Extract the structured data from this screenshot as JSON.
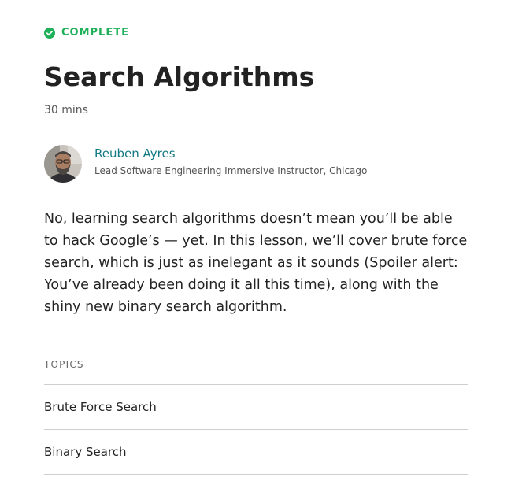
{
  "status": {
    "label": "COMPLETE",
    "icon": "check-circle-icon",
    "color": "#1fb05a"
  },
  "lesson": {
    "title": "Search Algorithms",
    "duration": "30 mins",
    "description": "No, learning search algorithms doesn’t mean you’ll be able to hack Google’s — yet. In this lesson, we’ll cover brute force search, which is just as inelegant as it sounds (Spoiler alert: You’ve already been doing it all this time), along with the shiny new binary search algorithm."
  },
  "author": {
    "name": "Reuben Ayres",
    "role": "Lead Software Engineering Immersive Instructor, Chicago",
    "name_color": "#137a83"
  },
  "topics": {
    "heading": "TOPICS",
    "items": [
      {
        "label": "Brute Force Search"
      },
      {
        "label": "Binary Search"
      }
    ]
  }
}
